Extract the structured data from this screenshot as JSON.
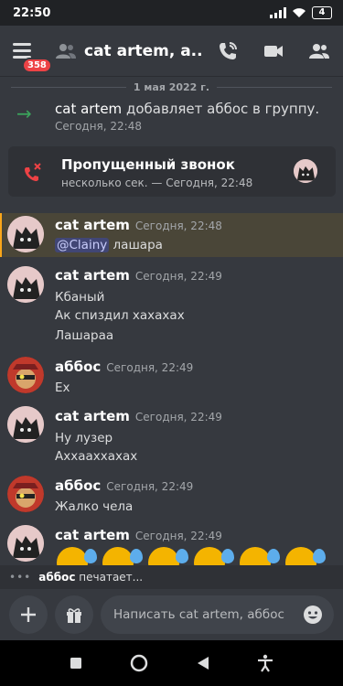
{
  "status": {
    "time": "22:50",
    "battery": "4"
  },
  "header": {
    "badge_count": "358",
    "title": "cat artem, a..."
  },
  "date_separator": "1 мая 2022 г.",
  "system_message": {
    "author": "cat artem",
    "action": "добавляет аббос в группу.",
    "timestamp": "Сегодня, 22:48"
  },
  "missed_call": {
    "title": "Пропущенный звонок",
    "subtitle": "несколько сек. — Сегодня, 22:48"
  },
  "messages": [
    {
      "author": "cat artem",
      "time": "Сегодня, 22:48",
      "mention": "@Clainy",
      "lines": [
        "лашара"
      ]
    },
    {
      "author": "cat artem",
      "time": "Сегодня, 22:49",
      "lines": [
        "Кбаный",
        "Ак спиздил хахахах",
        "Лашараа"
      ]
    },
    {
      "author": "аббос",
      "time": "Сегодня, 22:49",
      "lines": [
        "Ех"
      ]
    },
    {
      "author": "cat artem",
      "time": "Сегодня, 22:49",
      "lines": [
        "Ну лузер",
        "Аххааххахах"
      ]
    },
    {
      "author": "аббос",
      "time": "Сегодня, 22:49",
      "lines": [
        "Жалко чела"
      ]
    },
    {
      "author": "cat artem",
      "time": "Сегодня, 22:49",
      "emoji": "sweat-smile-emoji"
    }
  ],
  "typing_indicator": {
    "user": "аббос",
    "text": "печатает..."
  },
  "composer": {
    "placeholder": "Написать cat artem, аббос"
  },
  "colors": {
    "accent_green": "#3ba55c",
    "missed_red": "#ed4245",
    "highlight_border": "#faa61a"
  }
}
